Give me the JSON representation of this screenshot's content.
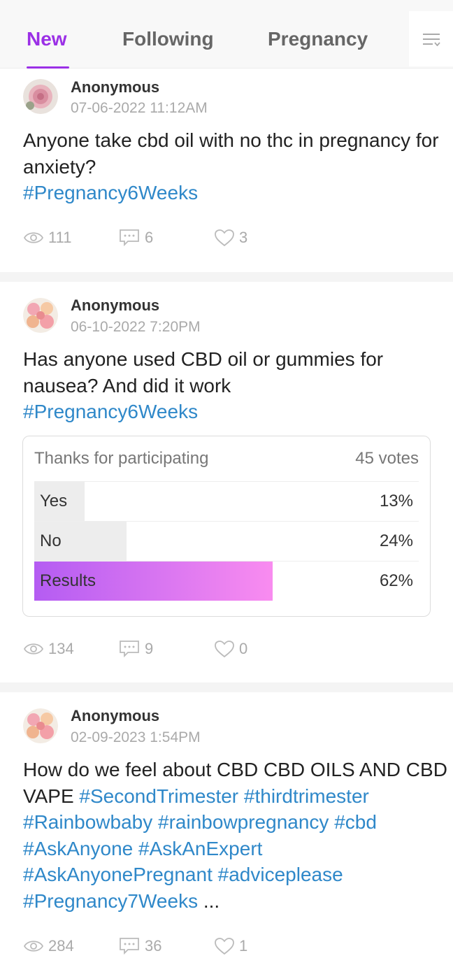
{
  "tabs": {
    "new": "New",
    "following": "Following",
    "pregnancy": "Pregnancy"
  },
  "posts": [
    {
      "author": "Anonymous",
      "date": "07-06-2022 11:12AM",
      "text": "Anyone take cbd oil with no thc in pregnancy for anxiety?",
      "tags": [
        "#Pregnancy6Weeks"
      ],
      "views": "111",
      "comments": "6",
      "likes": "3"
    },
    {
      "author": "Anonymous",
      "date": "06-10-2022 7:20PM",
      "text": "Has anyone used CBD oil or gummies for nausea? And did it work",
      "tags": [
        "#Pregnancy6Weeks"
      ],
      "poll": {
        "header": "Thanks for participating",
        "votes": "45 votes",
        "options": [
          {
            "label": "Yes",
            "percent": "13%",
            "fraction": 0.13
          },
          {
            "label": "No",
            "percent": "24%",
            "fraction": 0.24
          },
          {
            "label": "Results",
            "percent": "62%",
            "fraction": 0.62
          }
        ]
      },
      "views": "134",
      "comments": "9",
      "likes": "0"
    },
    {
      "author": "Anonymous",
      "date": "02-09-2023 1:54PM",
      "text": "How do we feel about CBD CBD OILS AND CBD VAPE",
      "tags": [
        "#SecondTrimester",
        "#thirdtrimester",
        "#Rainbowbaby",
        "#rainbowpregnancy",
        "#cbd",
        "#AskAnyone",
        "#AskAnExpert",
        "#AskAnyonePregnant",
        "#adviceplease",
        "#Pregnancy7Weeks"
      ],
      "ellipsis": "...",
      "views": "284",
      "comments": "36",
      "likes": "1"
    }
  ],
  "colors": {
    "accent": "#9b30e6",
    "hashtag": "#2f88c9",
    "poll_gradient_start": "#b45cf2",
    "poll_gradient_end": "#f98cf0"
  }
}
